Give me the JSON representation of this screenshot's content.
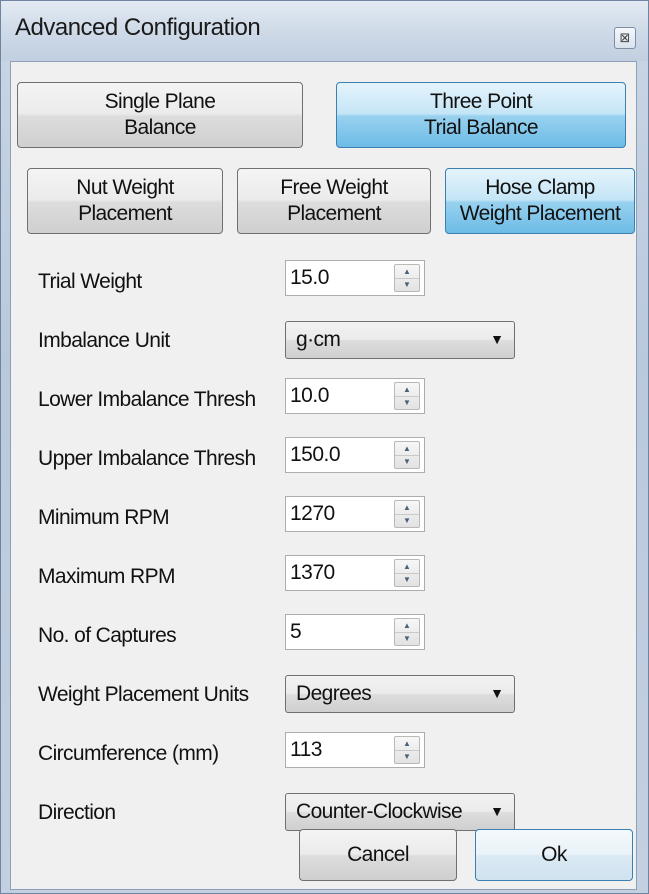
{
  "window": {
    "title": "Advanced Configuration",
    "close_glyph": "⊠"
  },
  "modes": {
    "single_plane": "Single Plane\nBalance",
    "three_point": "Three Point\nTrial Balance"
  },
  "placement": {
    "nut_weight": "Nut Weight\nPlacement",
    "free_weight": "Free Weight\nPlacement",
    "hose_clamp": "Hose Clamp\nWeight Placement"
  },
  "fields": {
    "trial_weight": {
      "label": "Trial Weight",
      "value": "15.0"
    },
    "imbalance_unit": {
      "label": "Imbalance Unit",
      "value": "g·cm"
    },
    "lower_thresh": {
      "label": "Lower Imbalance Thresh",
      "value": "10.0"
    },
    "upper_thresh": {
      "label": "Upper Imbalance Thresh",
      "value": "150.0"
    },
    "min_rpm": {
      "label": "Minimum RPM",
      "value": "1270"
    },
    "max_rpm": {
      "label": "Maximum RPM",
      "value": "1370"
    },
    "captures": {
      "label": "No. of Captures",
      "value": "5"
    },
    "placement_units": {
      "label": "Weight Placement Units",
      "value": "Degrees"
    },
    "circumference": {
      "label": "Circumference (mm)",
      "value": "113"
    },
    "direction": {
      "label": "Direction",
      "value": "Counter-Clockwise"
    }
  },
  "icons": {
    "spin_up": "▲",
    "spin_down": "▼",
    "dropdown": "▼"
  },
  "actions": {
    "cancel": "Cancel",
    "ok": "Ok"
  },
  "colors": {
    "active_button": "#98d1ef",
    "active_border": "#3c7fb1"
  }
}
